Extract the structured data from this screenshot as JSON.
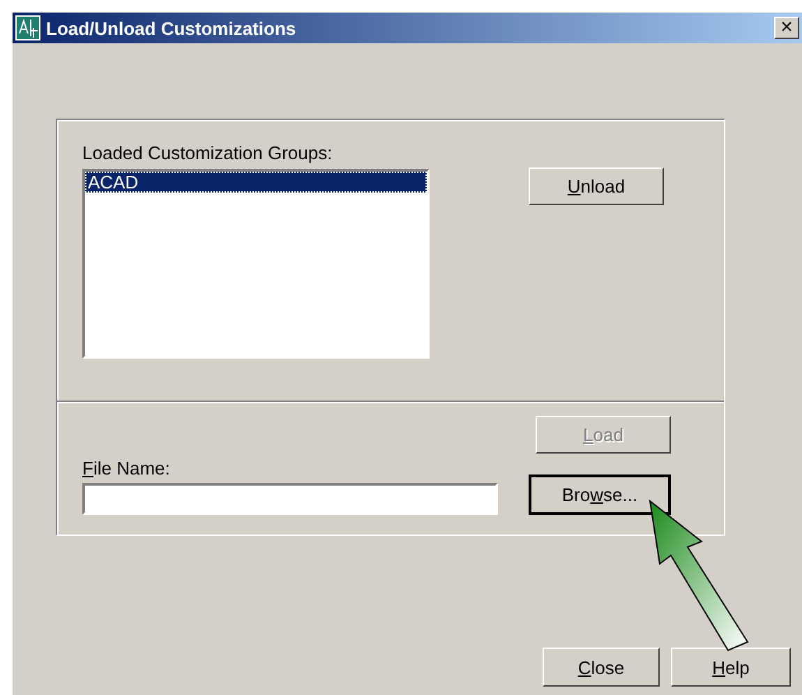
{
  "window": {
    "title": "Load/Unload Customizations",
    "close": "×"
  },
  "groups": {
    "label": "Loaded Customization Groups:",
    "items": [
      {
        "text": "ACAD",
        "selected": true
      }
    ]
  },
  "unload_button": {
    "label": {
      "key": "U",
      "after": "nload"
    },
    "disabled": false
  },
  "load_button": {
    "label": {
      "key": "L",
      "after": "oad"
    },
    "disabled": true
  },
  "file_name": {
    "label": {
      "key": "F",
      "after": "ile Name:"
    }
  },
  "browse_button": {
    "label": {
      "before": "Bro",
      "key": "w",
      "after": "se..."
    },
    "disabled": false,
    "focused": true
  },
  "footer_buttons": [
    {
      "label": {
        "key": "C",
        "after": "lose"
      }
    },
    {
      "label": {
        "key": "H",
        "after": "elp"
      }
    }
  ]
}
